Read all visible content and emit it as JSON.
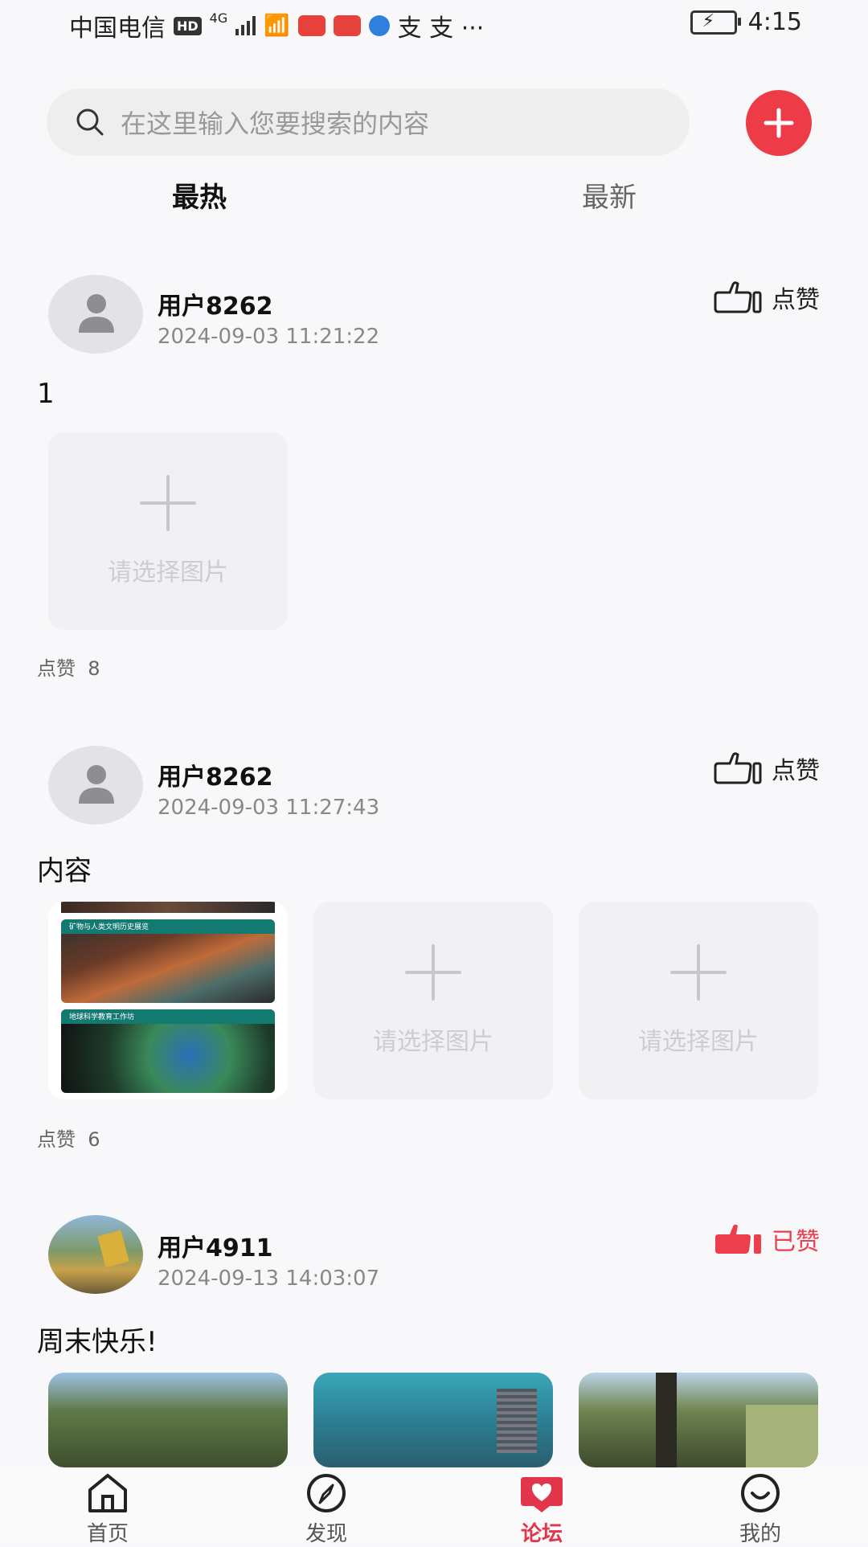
{
  "status_bar": {
    "carrier": "中国电信",
    "hd": "HD",
    "network": "4G",
    "extra": "支 支 ···",
    "time": "4:15"
  },
  "search": {
    "placeholder": "在这里输入您要搜索的内容"
  },
  "tabs": [
    {
      "label": "最热",
      "active": true
    },
    {
      "label": "最新",
      "active": false
    }
  ],
  "posts": [
    {
      "username": "用户8262",
      "time": "2024-09-03 11:21:22",
      "like_label": "点赞",
      "content": "1",
      "slot_text": "请选择图片",
      "likes_label": "点赞",
      "likes": "8"
    },
    {
      "username": "用户8262",
      "time": "2024-09-03 11:27:43",
      "like_label": "点赞",
      "content": "内容",
      "slot_text": "请选择图片",
      "likes_label": "点赞",
      "likes": "6",
      "poster_titles": [
        "矿物与人类文明历史展览",
        "地球科学教育工作坊"
      ]
    },
    {
      "username": "用户4911",
      "time": "2024-09-13 14:03:07",
      "like_label": "已赞",
      "content": "周末快乐!"
    }
  ],
  "nav": [
    {
      "label": "首页",
      "icon": "home-icon"
    },
    {
      "label": "发现",
      "icon": "compass-icon"
    },
    {
      "label": "论坛",
      "icon": "forum-heart-icon",
      "active": true
    },
    {
      "label": "我的",
      "icon": "smile-icon"
    }
  ],
  "colors": {
    "accent": "#ee3b48",
    "liked": "#ec3e4c",
    "nav_active": "#e2344a"
  }
}
